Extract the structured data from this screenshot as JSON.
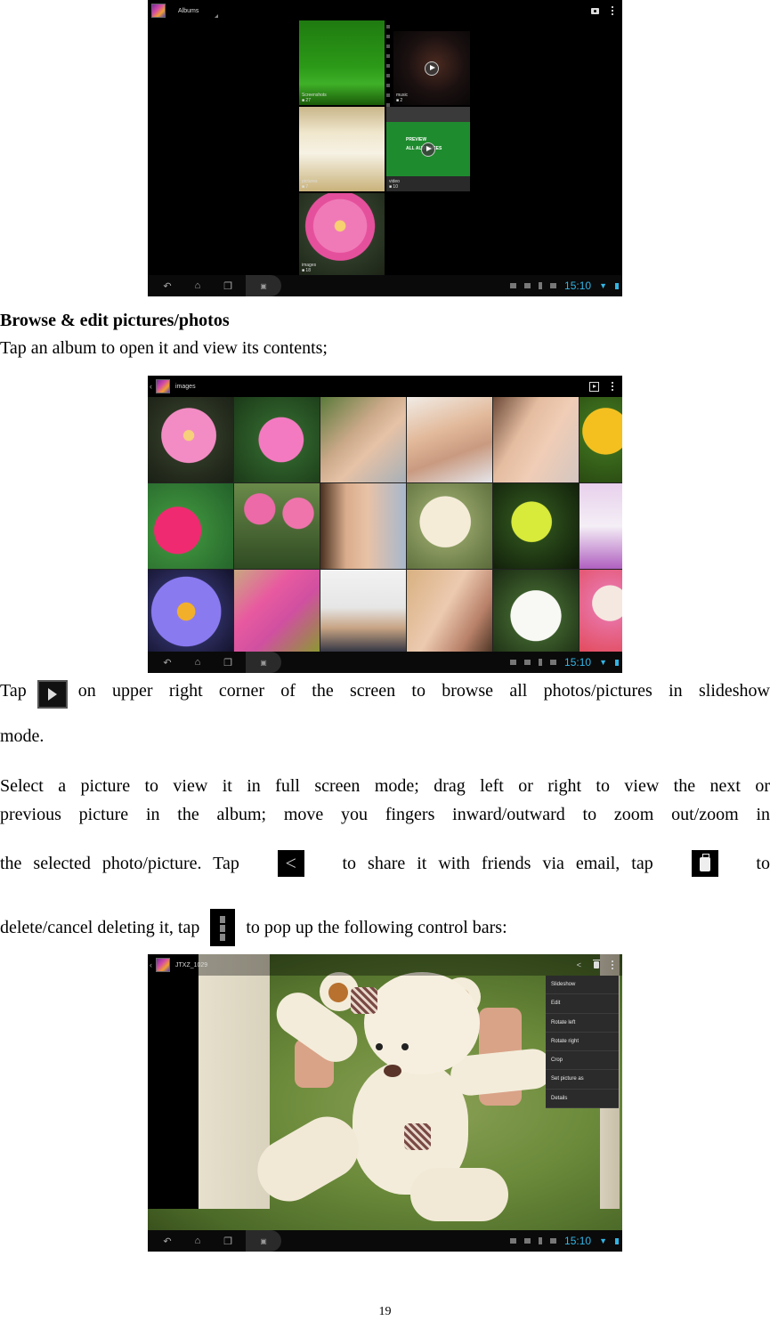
{
  "screenshot1": {
    "action_bar": {
      "title": "Albums"
    },
    "albums": [
      {
        "name": "Screenshots",
        "count": "27"
      },
      {
        "name": "music",
        "count": "2"
      },
      {
        "name": "pictures",
        "count": "7"
      },
      {
        "name": "video",
        "count": "10"
      },
      {
        "name": "images",
        "count": "18"
      }
    ],
    "video_overlay": {
      "line1": "PREVIEW",
      "line2": "ALL AUDIENCES"
    }
  },
  "screenshot2": {
    "action_bar": {
      "title": "images"
    }
  },
  "screenshot3": {
    "action_bar": {
      "title": "JTXZ_1029"
    },
    "menu_items": [
      "Slideshow",
      "Edit",
      "Rotate left",
      "Rotate right",
      "Crop",
      "Set picture as",
      "Details"
    ]
  },
  "system_bar": {
    "clock": "15:10"
  },
  "text": {
    "heading": "Browse & edit pictures/photos",
    "open_album": "Tap an album to open it and view its contents;",
    "slideshow_pre": "Tap",
    "slideshow_post": "on upper right corner of the screen to browse all photos/pictures in slideshow",
    "slideshow_end": "mode.",
    "select_line1": "Select a picture to view it in full screen mode; drag left or right to view the next or",
    "select_line2": "previous picture in the album; move you fingers inward/outward to zoom out/zoom in",
    "share_pre": "the selected photo/picture. Tap",
    "share_mid": "to share it with friends via email, tap",
    "share_post": "to",
    "delete_pre": "delete/cancel deleting it, tap",
    "delete_post": "to pop up the following control bars:"
  },
  "page_number": "19",
  "colors": {
    "accent": "#33b5e5",
    "menu_bg": "#2b2b2b"
  }
}
